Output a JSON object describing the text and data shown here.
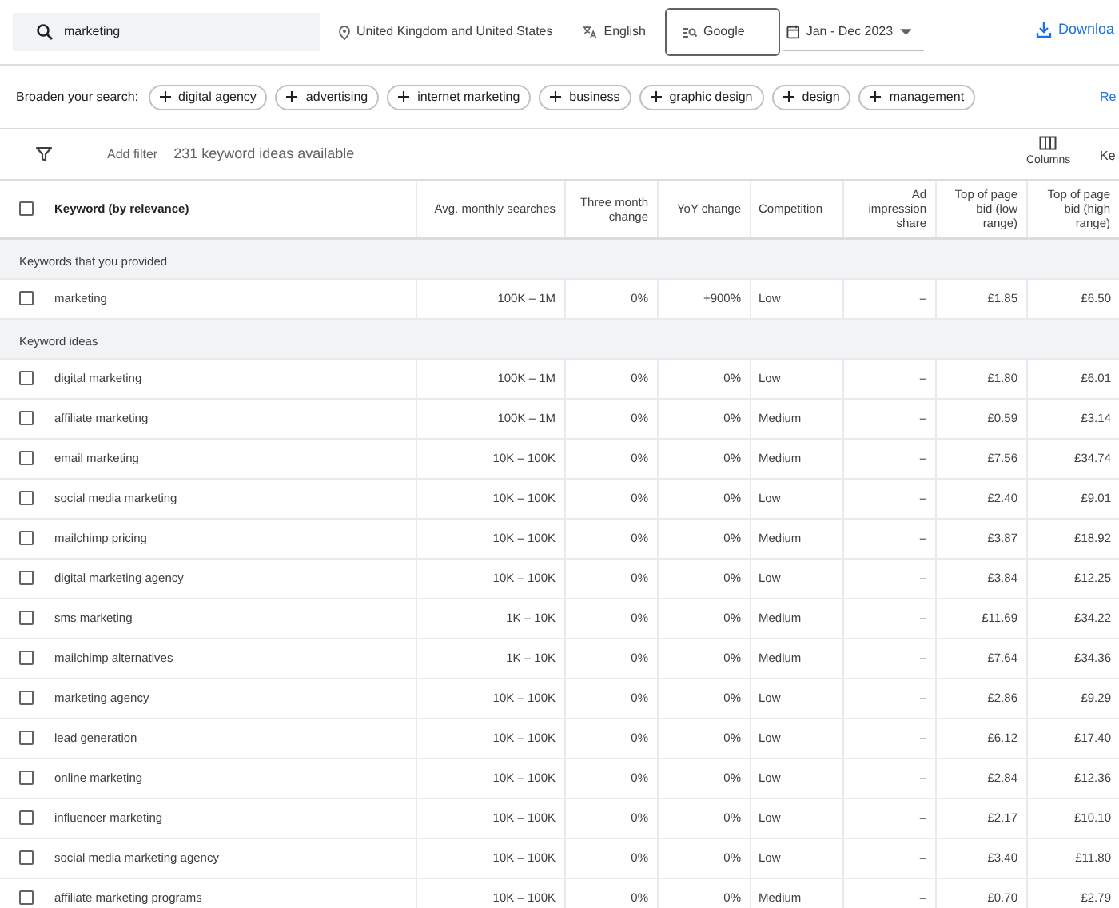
{
  "toolbar": {
    "search": {
      "value": "marketing"
    },
    "location": "United Kingdom and United States",
    "language": "English",
    "network": "Google",
    "date_range": "Jan - Dec 2023",
    "download": "Downloa"
  },
  "broaden": {
    "label": "Broaden your search:",
    "chips": [
      "digital agency",
      "advertising",
      "internet marketing",
      "business",
      "graphic design",
      "design",
      "management"
    ],
    "cut_link": "Re"
  },
  "filter_bar": {
    "add_filter": "Add filter",
    "count": "231 keyword ideas available",
    "columns": "Columns",
    "cut_label": "Ke"
  },
  "table": {
    "header_checked": false,
    "columns": [
      "Keyword (by relevance)",
      "Avg. monthly searches",
      "Three month change",
      "YoY change",
      "Competition",
      "Ad impression share",
      "Top of page bid (low range)",
      "Top of page bid (high range)"
    ],
    "groups": [
      {
        "title": "Keywords that you provided",
        "rows": [
          {
            "checked": false,
            "cells": [
              "marketing",
              "100K – 1M",
              "0%",
              "+900%",
              "Low",
              "–",
              "£1.85",
              "£6.50"
            ]
          }
        ]
      },
      {
        "title": "Keyword ideas",
        "rows": [
          {
            "checked": false,
            "cells": [
              "digital marketing",
              "100K – 1M",
              "0%",
              "0%",
              "Low",
              "–",
              "£1.80",
              "£6.01"
            ]
          },
          {
            "checked": false,
            "cells": [
              "affiliate marketing",
              "100K – 1M",
              "0%",
              "0%",
              "Medium",
              "–",
              "£0.59",
              "£3.14"
            ]
          },
          {
            "checked": false,
            "cells": [
              "email marketing",
              "10K – 100K",
              "0%",
              "0%",
              "Medium",
              "–",
              "£7.56",
              "£34.74"
            ]
          },
          {
            "checked": false,
            "cells": [
              "social media marketing",
              "10K – 100K",
              "0%",
              "0%",
              "Low",
              "–",
              "£2.40",
              "£9.01"
            ]
          },
          {
            "checked": false,
            "cells": [
              "mailchimp pricing",
              "10K – 100K",
              "0%",
              "0%",
              "Medium",
              "–",
              "£3.87",
              "£18.92"
            ]
          },
          {
            "checked": false,
            "cells": [
              "digital marketing agency",
              "10K – 100K",
              "0%",
              "0%",
              "Low",
              "–",
              "£3.84",
              "£12.25"
            ]
          },
          {
            "checked": false,
            "cells": [
              "sms marketing",
              "1K – 10K",
              "0%",
              "0%",
              "Medium",
              "–",
              "£11.69",
              "£34.22"
            ]
          },
          {
            "checked": false,
            "cells": [
              "mailchimp alternatives",
              "1K – 10K",
              "0%",
              "0%",
              "Medium",
              "–",
              "£7.64",
              "£34.36"
            ]
          },
          {
            "checked": false,
            "cells": [
              "marketing agency",
              "10K – 100K",
              "0%",
              "0%",
              "Low",
              "–",
              "£2.86",
              "£9.29"
            ]
          },
          {
            "checked": false,
            "cells": [
              "lead generation",
              "10K – 100K",
              "0%",
              "0%",
              "Low",
              "–",
              "£6.12",
              "£17.40"
            ]
          },
          {
            "checked": false,
            "cells": [
              "online marketing",
              "10K – 100K",
              "0%",
              "0%",
              "Low",
              "–",
              "£2.84",
              "£12.36"
            ]
          },
          {
            "checked": false,
            "cells": [
              "influencer marketing",
              "10K – 100K",
              "0%",
              "0%",
              "Low",
              "–",
              "£2.17",
              "£10.10"
            ]
          },
          {
            "checked": false,
            "cells": [
              "social media marketing agency",
              "10K – 100K",
              "0%",
              "0%",
              "Low",
              "–",
              "£3.40",
              "£11.80"
            ]
          },
          {
            "checked": false,
            "cells": [
              "affiliate marketing programs",
              "10K – 100K",
              "0%",
              "0%",
              "Medium",
              "–",
              "£0.70",
              "£2.79"
            ]
          }
        ]
      }
    ]
  }
}
